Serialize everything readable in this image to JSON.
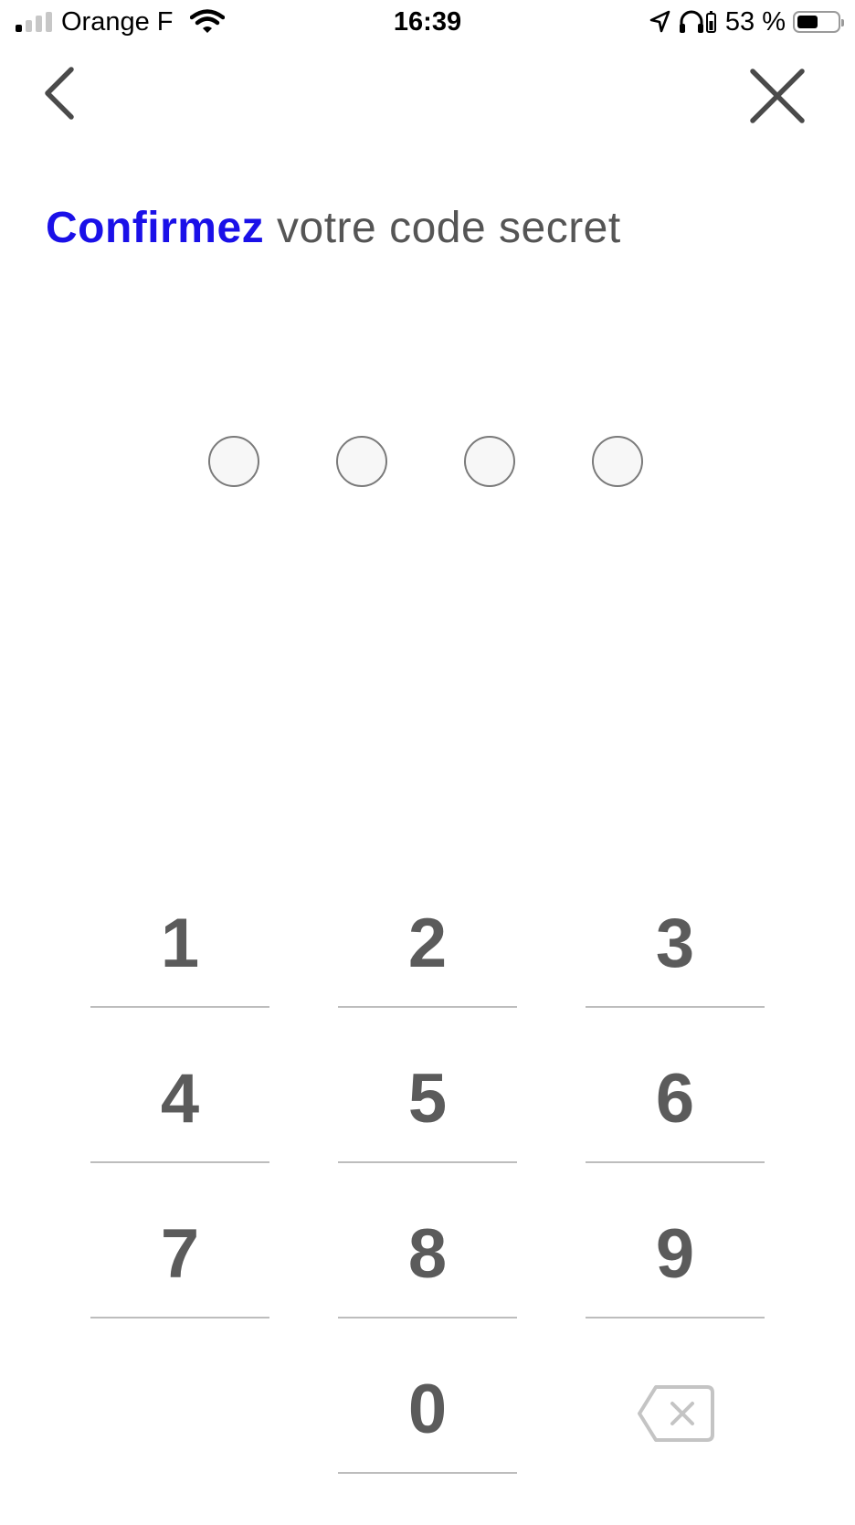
{
  "status_bar": {
    "carrier": "Orange F",
    "time": "16:39",
    "battery_percent": "53 %",
    "battery_level": 0.53,
    "signal_bars_active": 1,
    "signal_bars_total": 4
  },
  "nav": {
    "back_icon": "chevron-left-icon",
    "close_icon": "close-icon"
  },
  "title": {
    "accent": "Confirmez",
    "rest": " votre code secret",
    "accent_color": "#1a10e8"
  },
  "pin": {
    "length": 4,
    "filled": 0
  },
  "keypad": {
    "keys": [
      "1",
      "2",
      "3",
      "4",
      "5",
      "6",
      "7",
      "8",
      "9",
      "0"
    ],
    "delete_icon": "backspace-icon"
  },
  "colors": {
    "text": "#555555",
    "digit": "#5b5b5b",
    "divider": "#bdbdbd"
  }
}
